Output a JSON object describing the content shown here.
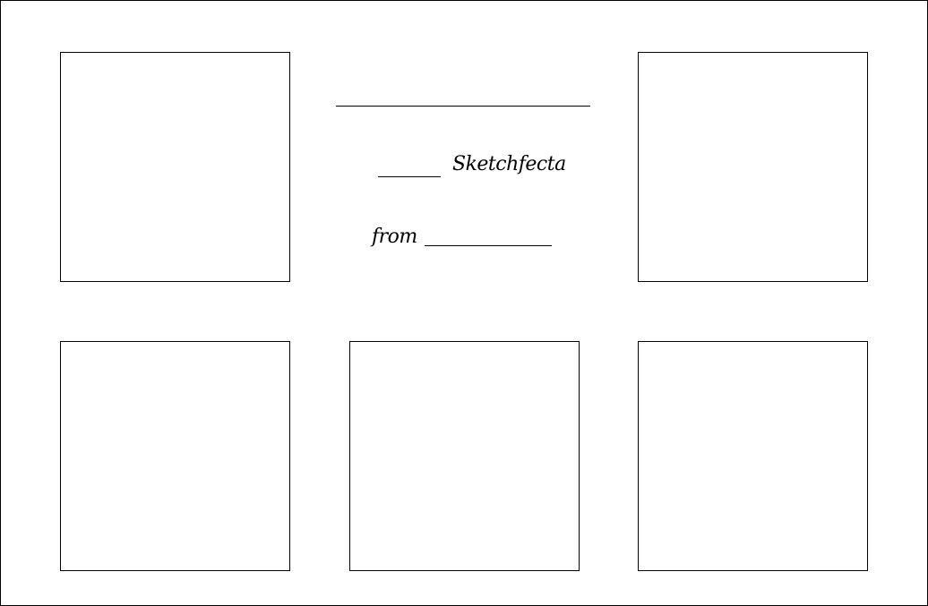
{
  "header": {
    "series_word": "Sketchfecta",
    "from_word": "from"
  },
  "panels": [
    {
      "id": "top-left"
    },
    {
      "id": "top-right"
    },
    {
      "id": "bottom-left"
    },
    {
      "id": "bottom-center"
    },
    {
      "id": "bottom-right"
    }
  ],
  "colors": {
    "ink": "#000000",
    "paper": "#ffffff"
  }
}
